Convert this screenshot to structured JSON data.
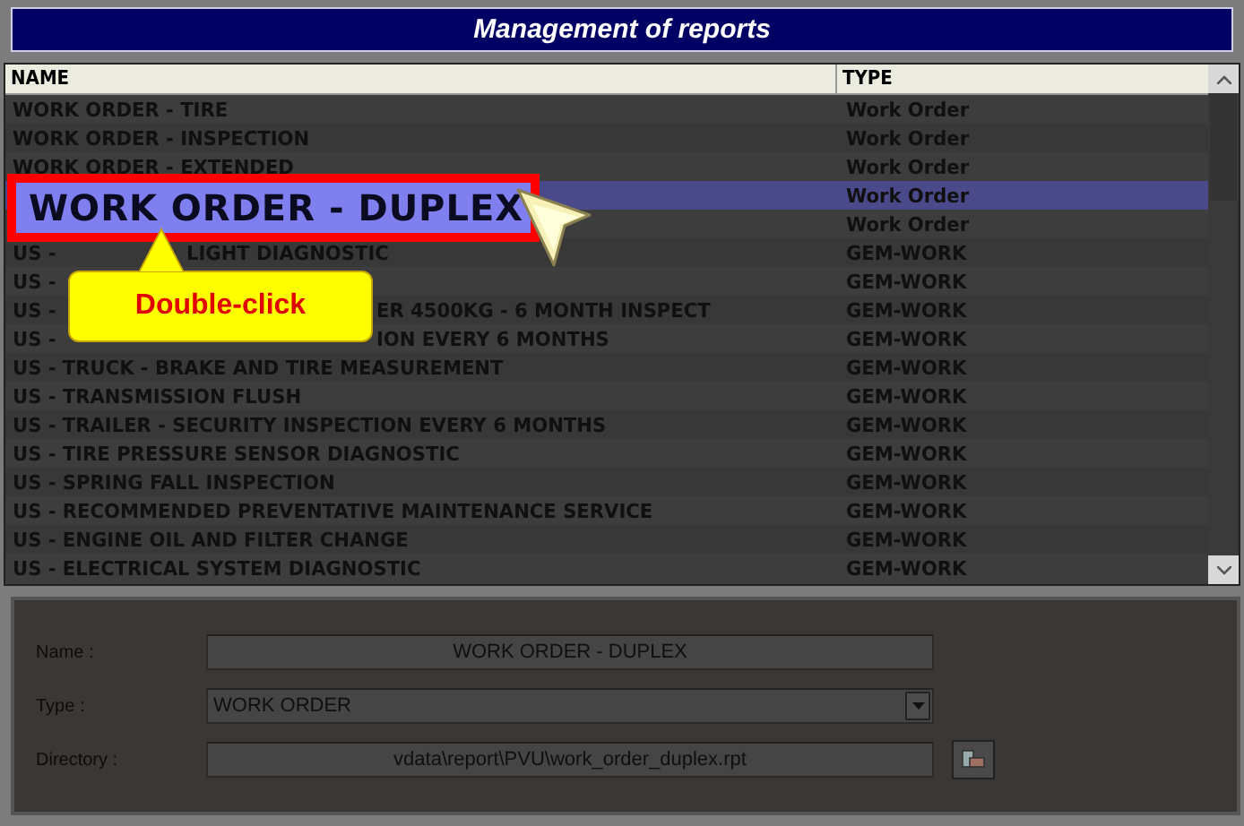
{
  "window": {
    "title": "Management of reports"
  },
  "table": {
    "columns": [
      "NAME",
      "TYPE"
    ],
    "rows": [
      {
        "kind": "full",
        "name": "WORK ORDER - TIRE",
        "type": "Work Order",
        "selected": false
      },
      {
        "kind": "full",
        "name": "WORK ORDER - INSPECTION",
        "type": "Work Order",
        "selected": false
      },
      {
        "kind": "full",
        "name": "WORK ORDER - EXTENDED",
        "type": "Work Order",
        "selected": false
      },
      {
        "kind": "hidden",
        "type": "Work Order",
        "selected": true
      },
      {
        "kind": "hidden",
        "type": "Work Order",
        "selected": false
      },
      {
        "kind": "split-near",
        "name": "US -",
        "tail": "LIGHT DIAGNOSTIC",
        "type": "GEM-WORK",
        "selected": false
      },
      {
        "kind": "split",
        "name": "US -",
        "type": "GEM-WORK",
        "selected": false
      },
      {
        "kind": "split",
        "name": "US -",
        "tail": "ER 4500KG - 6 MONTH INSPECT",
        "type": "GEM-WORK",
        "selected": false
      },
      {
        "kind": "split",
        "name": "US -",
        "tail": "ION EVERY 6 MONTHS",
        "type": "GEM-WORK",
        "selected": false
      },
      {
        "kind": "full",
        "name": "US - TRUCK - BRAKE AND TIRE MEASUREMENT",
        "type": "GEM-WORK",
        "selected": false
      },
      {
        "kind": "full",
        "name": "US - TRANSMISSION FLUSH",
        "type": "GEM-WORK",
        "selected": false
      },
      {
        "kind": "full",
        "name": "US - TRAILER - SECURITY INSPECTION EVERY 6 MONTHS",
        "type": "GEM-WORK",
        "selected": false
      },
      {
        "kind": "full",
        "name": "US - TIRE PRESSURE SENSOR DIAGNOSTIC",
        "type": "GEM-WORK",
        "selected": false
      },
      {
        "kind": "full",
        "name": "US - SPRING FALL INSPECTION",
        "type": "GEM-WORK",
        "selected": false
      },
      {
        "kind": "full",
        "name": "US - RECOMMENDED PREVENTATIVE MAINTENANCE SERVICE",
        "type": "GEM-WORK",
        "selected": false
      },
      {
        "kind": "full",
        "name": "US - ENGINE OIL AND FILTER CHANGE",
        "type": "GEM-WORK",
        "selected": false
      },
      {
        "kind": "full",
        "name": "US - ELECTRICAL SYSTEM DIAGNOSTIC",
        "type": "GEM-WORK",
        "selected": false
      }
    ]
  },
  "callout": {
    "highlight": "WORK ORDER - DUPLEX",
    "tooltip": "Double-click"
  },
  "form": {
    "fields": [
      {
        "kind": "text",
        "label": "Name :",
        "value": "WORK ORDER - DUPLEX"
      },
      {
        "kind": "select",
        "label": "Type :",
        "value": "WORK ORDER"
      },
      {
        "kind": "browse",
        "label": "Directory :",
        "value": "vdata\\report\\PVU\\work_order_duplex.rpt"
      }
    ]
  }
}
